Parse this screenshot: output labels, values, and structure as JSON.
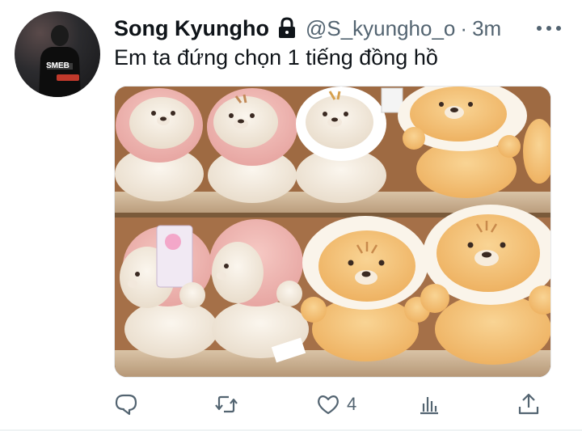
{
  "tweet": {
    "display_name": "Song Kyungho",
    "handle": "@S_kyungho_o",
    "separator": "·",
    "time": "3m",
    "text": "Em ta đứng chọn 1 tiếng đồng hồ",
    "protected": true,
    "avatar_icon": "avatar-person-icon",
    "avatar_jersey_text": "SMEB",
    "media_description_icon": "plush-lion-toys-photo"
  },
  "actions": {
    "reply_icon": "reply-icon",
    "retweet_icon": "retweet-icon",
    "like_icon": "heart-icon",
    "like_count": "4",
    "analytics_icon": "analytics-icon",
    "share_icon": "share-icon"
  },
  "colors": {
    "text_primary": "#0f1419",
    "text_secondary": "#536471",
    "background": "#ffffff"
  }
}
